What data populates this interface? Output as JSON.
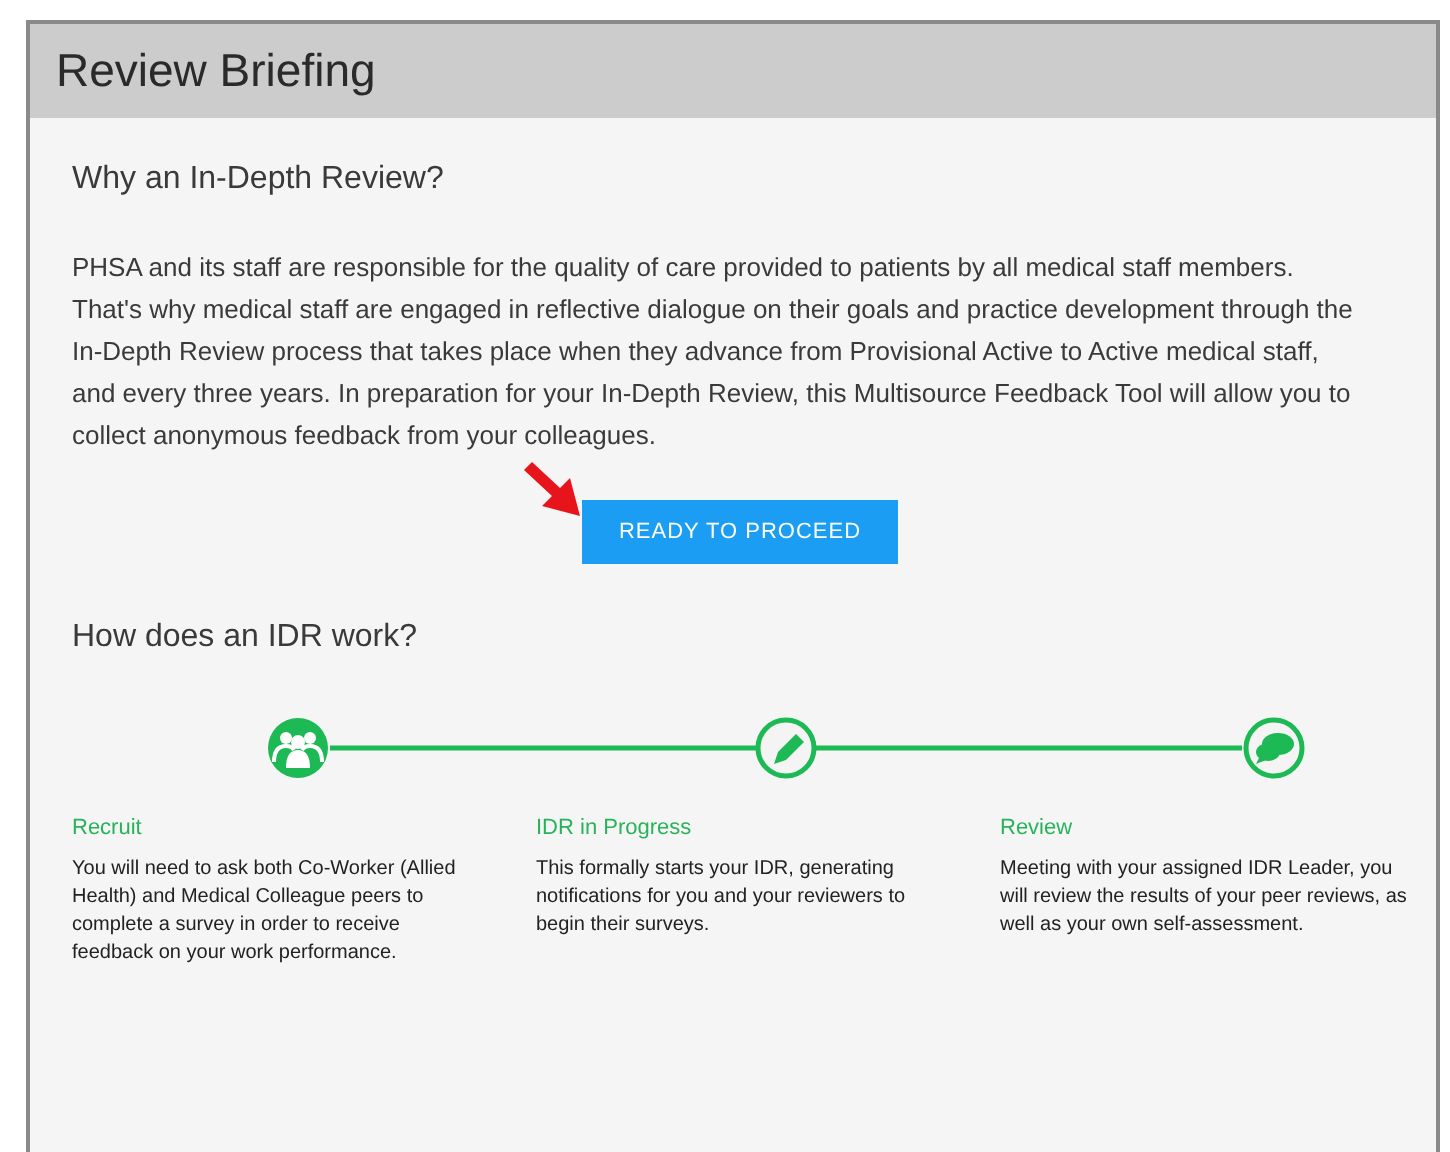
{
  "panel": {
    "title": "Review Briefing"
  },
  "intro": {
    "heading": "Why an In-Depth Review?",
    "text": "PHSA and its staff are responsible for the quality of care provided to patients by all medical staff members. That's why medical staff are engaged in reflective dialogue on their goals and practice development through the In-Depth Review process that takes place when they advance from Provisional Active to Active medical staff, and every three years. In preparation for your In-Depth Review, this Multisource Feedback Tool will allow you to collect anonymous feedback from your colleagues."
  },
  "button": {
    "label": "READY TO PROCEED"
  },
  "process": {
    "heading": "How does an IDR work?",
    "steps": [
      {
        "kind": "people",
        "title": "Recruit",
        "description": "You will need to ask both Co-Worker (Allied Health) and Medical Colleague peers to complete a survey in order to receive feedback on your work performance."
      },
      {
        "kind": "pencil",
        "title": "IDR in Progress",
        "description": "This formally starts your IDR, generating notifications for you and your reviewers to begin their surveys."
      },
      {
        "kind": "chat",
        "title": "Review",
        "description": "Meeting with your assigned IDR Leader, you will review the results of your peer reviews, as well as your own self-assessment."
      }
    ]
  }
}
